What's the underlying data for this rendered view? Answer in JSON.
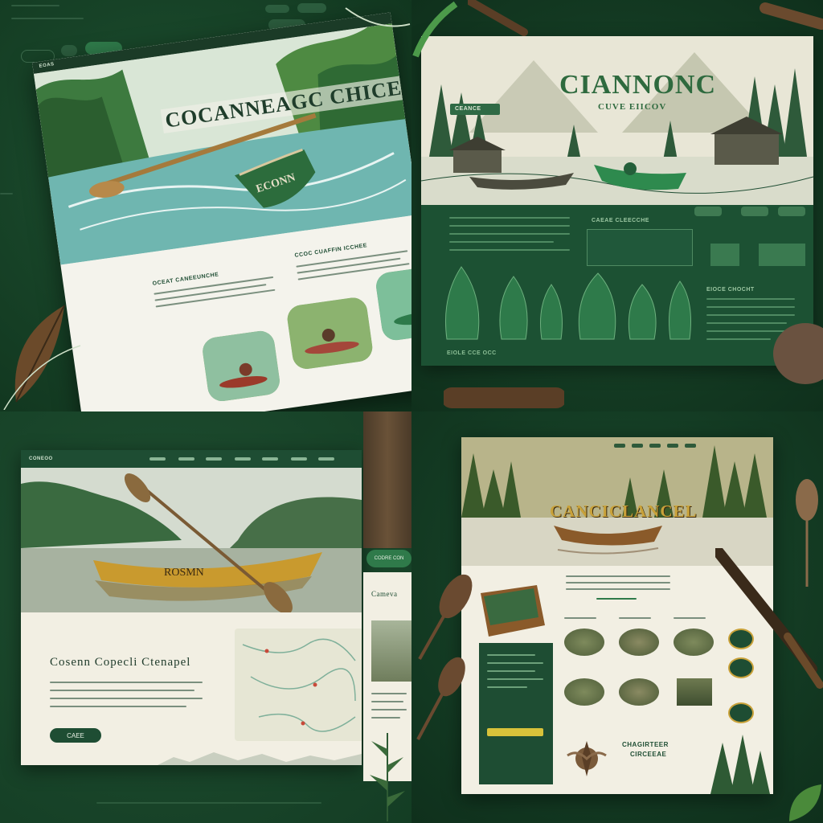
{
  "panel1": {
    "nav_label": "EOAS",
    "hero_title": "COCANNEAGC CHICEEL",
    "canoe_text": "ECONN",
    "section_left": "OCEAT CANEEUNCHE",
    "section_right": "CCOC CUAFFIN ICCHEE"
  },
  "panel2": {
    "hero_title": "CIANNONC",
    "hero_subtitle": "CUVE EIICOV",
    "badge_label": "CEANCE",
    "section_heading": "CAEAE CLEECCHE",
    "paddle_caption": "EIOLE CCE OCC",
    "side_heading": "EIOCE CHOCHT"
  },
  "panel3": {
    "nav_label": "CONEOO",
    "canoe_text": "ROSMN",
    "heading": "Cosenn Copecli  Ctenapel",
    "side_heading": "Cameva",
    "side_button": "CODRE CON",
    "cta_label": "CAEE"
  },
  "panel4": {
    "hero_title": "CANCICLANCEL",
    "lower_heading": "CHAGIRTEER",
    "lower_subheading": "CIRCEEAE"
  },
  "colors": {
    "forest": "#1e4d33",
    "accent": "#2f7a4a",
    "cream": "#f2efe3",
    "gold": "#c9a23a"
  }
}
